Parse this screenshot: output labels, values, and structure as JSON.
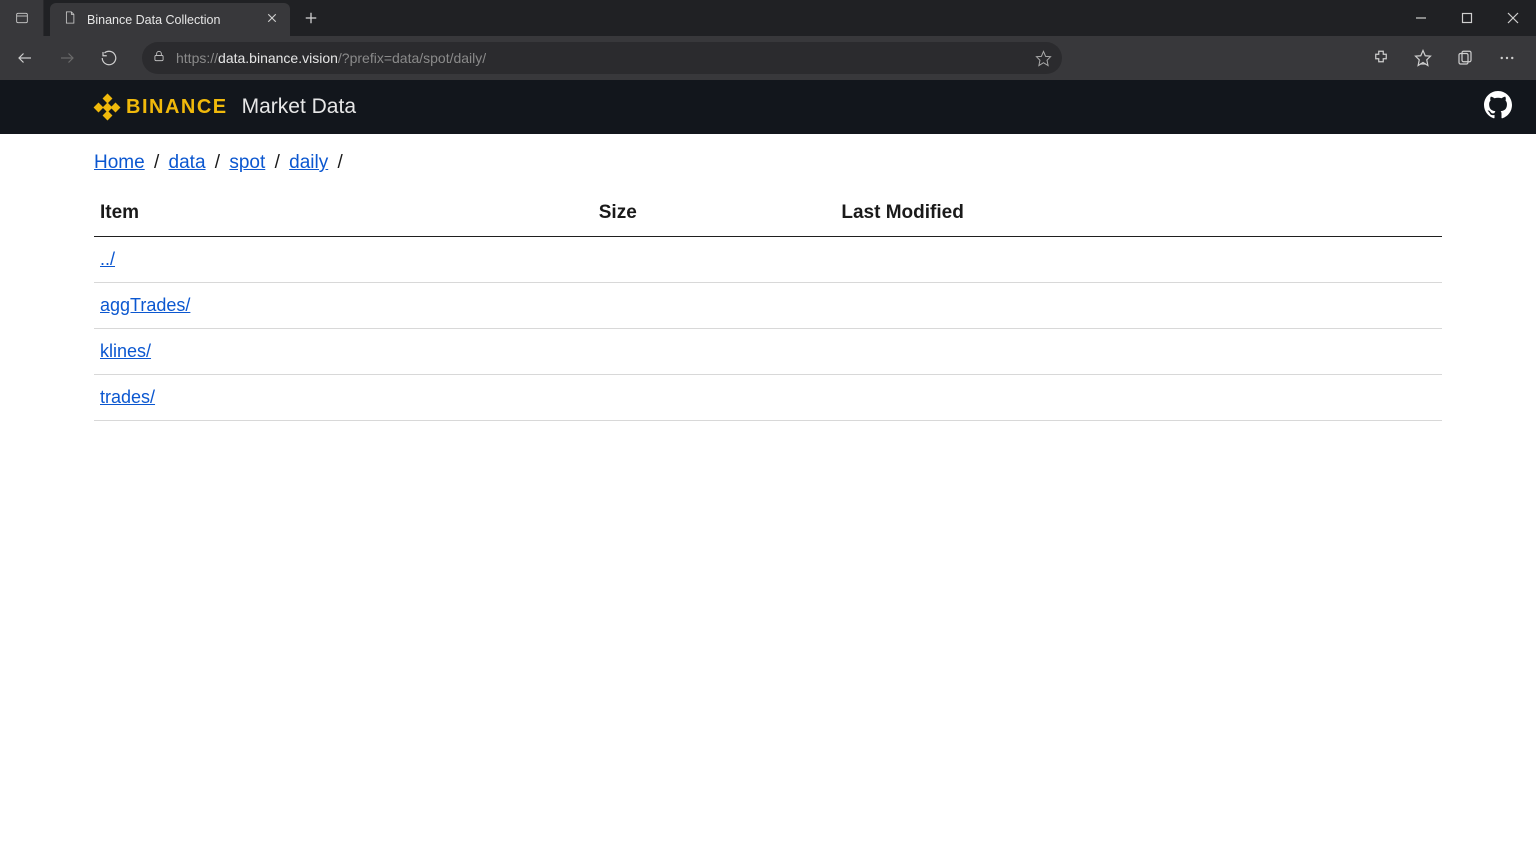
{
  "browser": {
    "tab_title": "Binance Data Collection",
    "url_protocol": "https",
    "url_colon_slashes": "://",
    "url_host": "data.binance.vision",
    "url_path": "/?prefix=data/spot/daily/"
  },
  "header": {
    "brand_word": "BINANCE",
    "title": "Market Data"
  },
  "breadcrumb": {
    "parts": [
      "Home",
      "data",
      "spot",
      "daily"
    ],
    "sep": "/"
  },
  "table": {
    "columns": [
      "Item",
      "Size",
      "Last Modified"
    ],
    "rows": [
      {
        "item": "../",
        "size": "",
        "modified": ""
      },
      {
        "item": "aggTrades/",
        "size": "",
        "modified": ""
      },
      {
        "item": "klines/",
        "size": "",
        "modified": ""
      },
      {
        "item": "trades/",
        "size": "",
        "modified": ""
      }
    ]
  }
}
